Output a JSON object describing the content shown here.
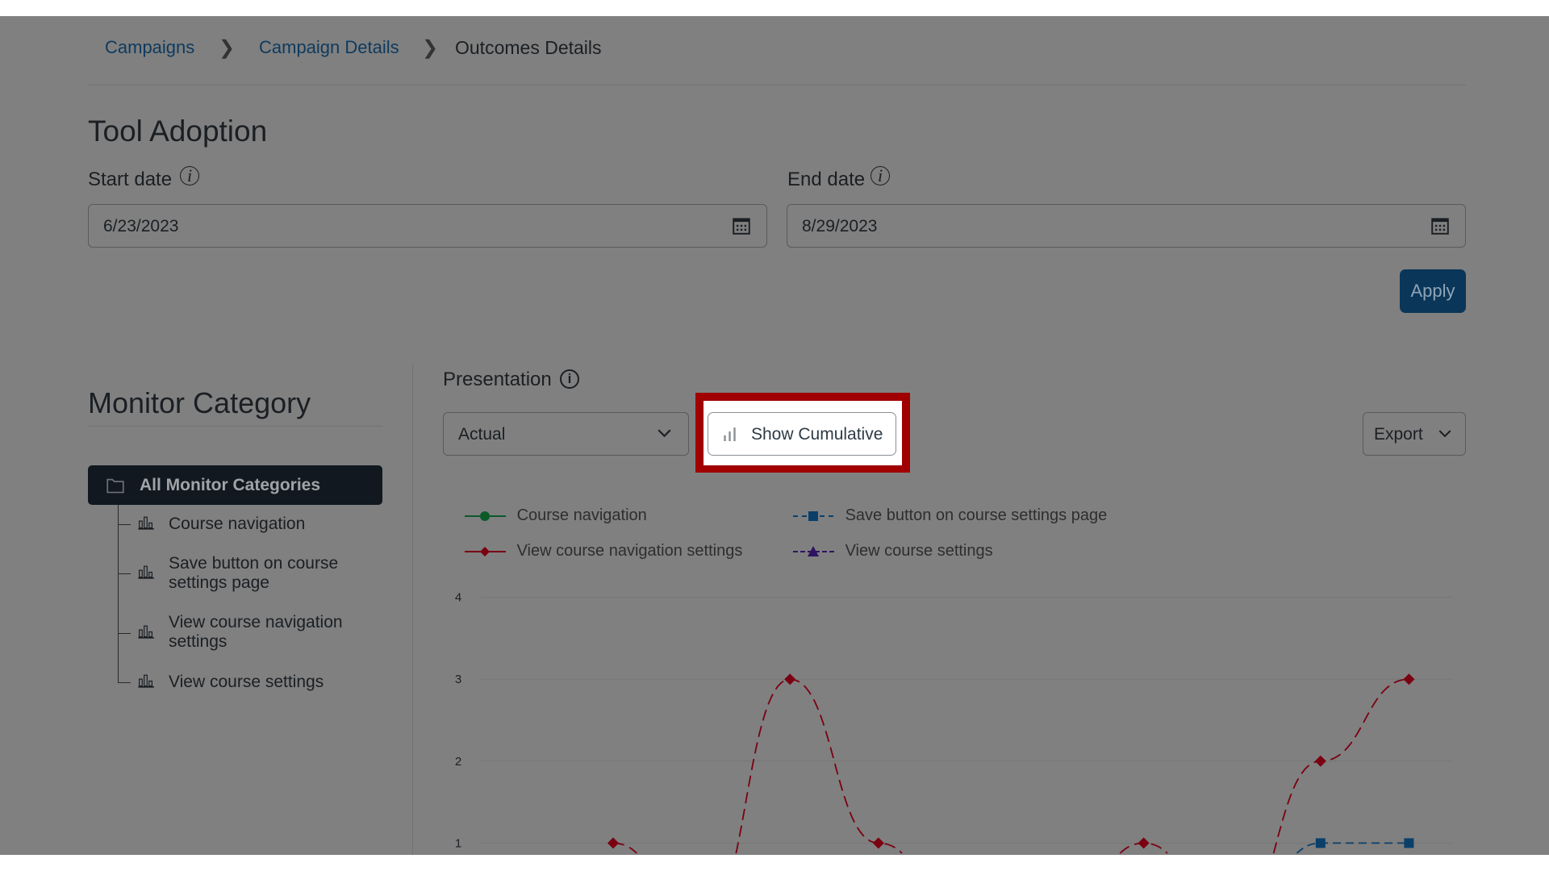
{
  "breadcrumb": {
    "items": [
      "Campaigns",
      "Campaign Details"
    ],
    "current": "Outcomes Details"
  },
  "page_title": "Tool Adoption",
  "start_date": {
    "label": "Start date",
    "value": "6/23/2023"
  },
  "end_date": {
    "label": "End date",
    "value": "8/29/2023"
  },
  "apply_label": "Apply",
  "monitor": {
    "title": "Monitor Category",
    "all": "All Monitor Categories",
    "items": [
      "Course navigation",
      "Save button on course settings page",
      "View course navigation settings",
      "View course settings"
    ]
  },
  "presentation": {
    "label": "Presentation",
    "select_value": "Actual",
    "cumulative_label": "Show Cumulative",
    "export_label": "Export"
  },
  "colors": {
    "accent": "#0a3659",
    "highlight": "#a00000",
    "course_navigation": "#0b5a2a",
    "save_button": "#0a3f6a",
    "view_nav_settings": "#7a0012",
    "view_settings": "#2e1460"
  },
  "chart_data": {
    "type": "line",
    "yticks": [
      "1",
      "2",
      "3",
      "4"
    ],
    "ylim": [
      0,
      4
    ],
    "grid": true,
    "legend_placement": "top",
    "series": [
      {
        "name": "Course navigation",
        "marker": "circle",
        "values": []
      },
      {
        "name": "Save button on course settings page",
        "marker": "square",
        "values": [
          0,
          0,
          0,
          0,
          0,
          0,
          0,
          0,
          1,
          1
        ]
      },
      {
        "name": "View course navigation settings",
        "marker": "diamond",
        "values": [
          1,
          0,
          3,
          1,
          0,
          0,
          1,
          0,
          2,
          3
        ]
      },
      {
        "name": "View course settings",
        "marker": "triangle",
        "values": []
      }
    ]
  }
}
